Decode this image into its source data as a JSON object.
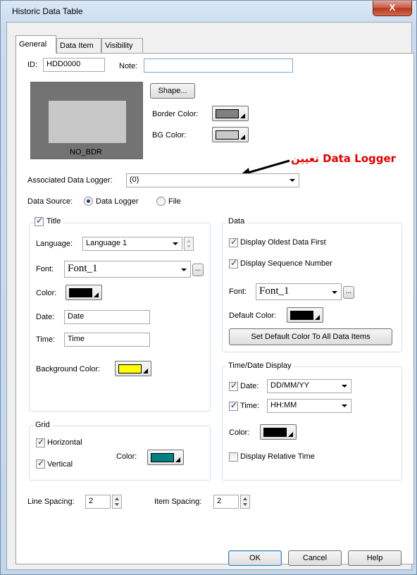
{
  "window": {
    "title": "Historic Data Table",
    "close_label": "X"
  },
  "tabs": [
    "General",
    "Data Item",
    "Visibility"
  ],
  "general": {
    "id_label": "ID:",
    "id_value": "HDD0000",
    "note_label": "Note:",
    "note_value": "",
    "preview_text": "NO_BDR",
    "shape_button": "Shape...",
    "border_color_label": "Border Color:",
    "border_color": "#808080",
    "bg_color_label": "BG Color:",
    "bg_color": "#c8c8c8",
    "annotation_text": "تعيين Data Logger",
    "annotation_color": "#e00000",
    "associated_logger_label": "Associated Data Logger:",
    "associated_logger_value": "(0)",
    "data_source_label": "Data Source:",
    "data_source_options": [
      "Data Logger",
      "File"
    ],
    "data_source_selected": "Data Logger"
  },
  "title_group": {
    "label": "Title",
    "checked": true,
    "language_label": "Language:",
    "language_value": "Language 1",
    "font_label": "Font:",
    "font_value": "Font_1",
    "ellipsis": "...",
    "color_label": "Color:",
    "color": "#000000",
    "date_label": "Date:",
    "date_value": "Date",
    "time_label": "Time:",
    "time_value": "Time",
    "bg_color_label": "Background Color:",
    "bg_color": "#ffff00"
  },
  "grid_group": {
    "label": "Grid",
    "horizontal_label": "Horizontal",
    "horizontal_checked": true,
    "vertical_label": "Vertical",
    "vertical_checked": true,
    "color_label": "Color:",
    "color": "#008080"
  },
  "data_group": {
    "label": "Data",
    "oldest_first_label": "Display Oldest Data First",
    "oldest_first_checked": true,
    "sequence_label": "Display Sequence Number",
    "sequence_checked": true,
    "font_label": "Font:",
    "font_value": "Font_1",
    "ellipsis": "...",
    "default_color_label": "Default Color:",
    "default_color": "#000000",
    "set_default_button": "Set Default Color To All Data Items"
  },
  "timedate_group": {
    "label": "Time/Date Display",
    "date_label": "Date:",
    "date_checked": true,
    "date_value": "DD/MM/YY",
    "time_label": "Time:",
    "time_checked": true,
    "time_value": "HH:MM",
    "color_label": "Color:",
    "color": "#000000",
    "relative_label": "Display Relative Time",
    "relative_checked": false
  },
  "spacing": {
    "line_label": "Line Spacing:",
    "line_value": "2",
    "item_label": "Item Spacing:",
    "item_value": "2"
  },
  "footer": {
    "ok": "OK",
    "cancel": "Cancel",
    "help": "Help"
  }
}
